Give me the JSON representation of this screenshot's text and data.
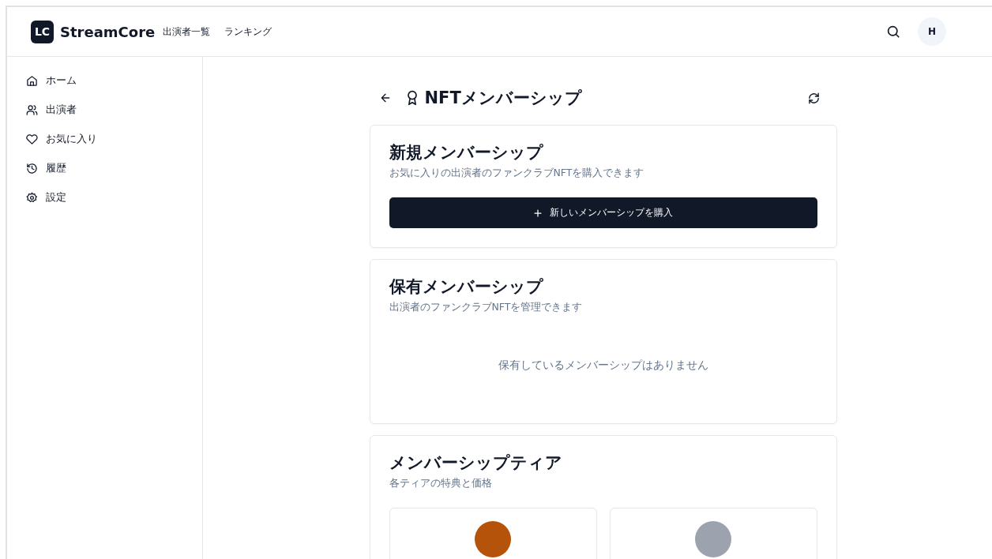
{
  "header": {
    "logo_mark": "LC",
    "brand": "StreamCore",
    "nav": [
      "出演者一覧",
      "ランキング"
    ],
    "avatar": "H"
  },
  "sidebar": {
    "items": [
      {
        "label": "ホーム",
        "kind": "home"
      },
      {
        "label": "出演者",
        "kind": "users"
      },
      {
        "label": "お気に入り",
        "kind": "heart"
      },
      {
        "label": "履歴",
        "kind": "history"
      },
      {
        "label": "設定",
        "kind": "settings"
      }
    ]
  },
  "page": {
    "title": "NFTメンバーシップ"
  },
  "new_membership": {
    "title": "新規メンバーシップ",
    "subtitle": "お気に入りの出演者のファンクラブNFTを購入できます",
    "button": "新しいメンバーシップを購入"
  },
  "owned": {
    "title": "保有メンバーシップ",
    "subtitle": "出演者のファンクラブNFTを管理できます",
    "empty": "保有しているメンバーシップはありません"
  },
  "tiers": {
    "title": "メンバーシップティア",
    "subtitle": "各ティアの特典と価格",
    "items": [
      {
        "color": "#b45309"
      },
      {
        "color": "#9ca3af"
      }
    ]
  }
}
